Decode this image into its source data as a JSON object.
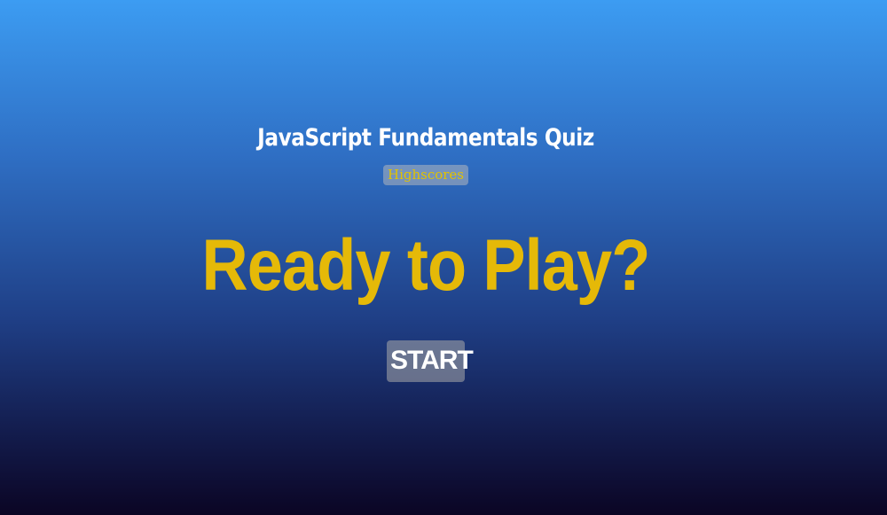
{
  "header": {
    "title": "JavaScript Fundamentals Quiz",
    "highscores_link": "Highscores"
  },
  "main": {
    "headline": "Ready to Play?",
    "start_button": "START"
  },
  "colors": {
    "accent_yellow": "#e5b908",
    "background_top": "#3c9cf2",
    "background_bottom": "#0b0524",
    "title_text": "#ffffff"
  }
}
